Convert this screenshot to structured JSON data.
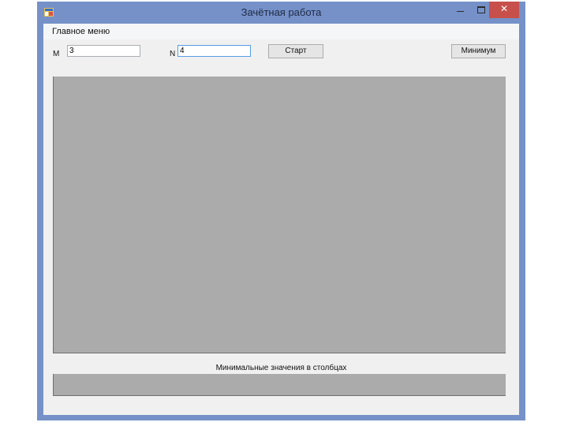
{
  "window": {
    "title": "Зачётная работа",
    "icon": "app-window-icon",
    "controls": [
      "minimize-icon",
      "maximize-icon",
      "close-icon"
    ]
  },
  "menu": {
    "items": [
      {
        "label": "Главное меню"
      }
    ]
  },
  "form": {
    "m_label": "M",
    "m_value": "3",
    "n_label": "N",
    "n_value": "4",
    "start_button": "Старт",
    "minimum_button": "Минимум"
  },
  "results": {
    "caption": "Минимальные значения в столбцах"
  },
  "colors": {
    "titlebar": "#7591c8",
    "close": "#c7504b",
    "client": "#f0f0f0",
    "grid_background": "#ababab"
  }
}
